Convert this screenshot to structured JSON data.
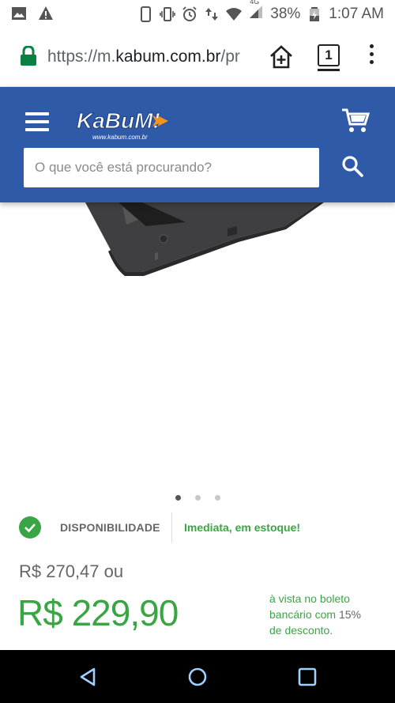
{
  "status_bar": {
    "battery_percent": "38%",
    "time": "1:07 AM",
    "network": "4G"
  },
  "browser": {
    "url_prefix": "https://m.",
    "url_domain": "kabum.com.br",
    "url_suffix": "/pr",
    "tab_count": "1"
  },
  "header": {
    "logo_text": "KaBuM!",
    "logo_sub": "www.kabum.com.br",
    "search_placeholder": "O que você está procurando?",
    "brand_color": "#2f5aa8"
  },
  "gallery": {
    "active_index": 0,
    "total": 3
  },
  "availability": {
    "label": "DISPONIBILIDADE",
    "status": "Imediata, em estoque!"
  },
  "pricing": {
    "old_price": "R$ 270,47 ou",
    "price": "R$ 229,90",
    "note_line1": "à vista no boleto bancário com",
    "note_discount": "15%",
    "note_line2": "de desconto.",
    "accent_color": "#3aa544"
  }
}
